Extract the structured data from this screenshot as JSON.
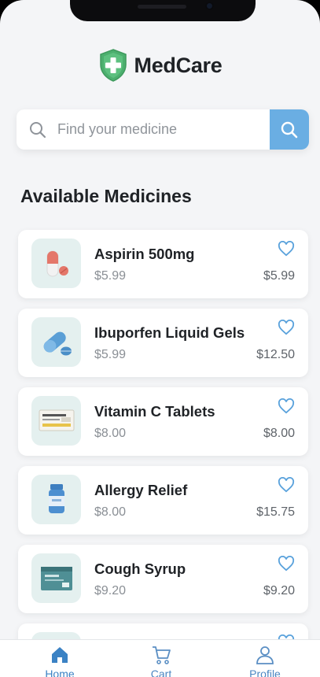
{
  "app": {
    "name": "MedCare"
  },
  "search": {
    "placeholder": "Find your medicine"
  },
  "section_title": "Available Medicines",
  "medicines": [
    {
      "name": "Aspirin 500mg",
      "price": "$5.99",
      "price_right": "$5.99",
      "icon": "capsule-icon"
    },
    {
      "name": "Ibuporfen Liquid Gels",
      "price": "$5.99",
      "price_right": "$12.50",
      "icon": "softgel-icon"
    },
    {
      "name": "Vitamin C Tablets",
      "price": "$8.00",
      "price_right": "$8.00",
      "icon": "tablet-box-icon"
    },
    {
      "name": "Allergy Relief",
      "price": "$8.00",
      "price_right": "$15.75",
      "icon": "pill-bottle-icon"
    },
    {
      "name": "Cough Syrup",
      "price": "$9.20",
      "price_right": "$9.20",
      "icon": "syrup-box-icon"
    }
  ],
  "tabs": [
    {
      "label": "Home",
      "icon": "home-icon"
    },
    {
      "label": "Cart",
      "icon": "cart-icon"
    },
    {
      "label": "Profile",
      "icon": "profile-icon"
    }
  ],
  "colors": {
    "accent": "#6aaee3",
    "brand_green": "#4caf6e",
    "heart": "#5aa2dc",
    "thumb_bg": "#e4f0ef"
  }
}
